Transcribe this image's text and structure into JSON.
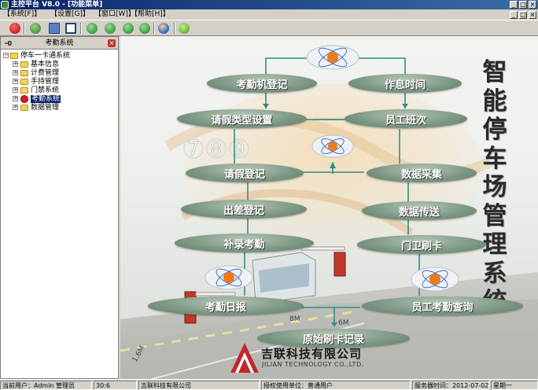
{
  "window": {
    "title": "主控平台 V8.0 - [功能菜单]",
    "controls": [
      "_",
      "□",
      "×"
    ]
  },
  "menu": {
    "items": [
      "【系统[F]】",
      "【设置[G]】",
      "【窗口[W]】",
      "【帮助[H]】"
    ],
    "mdi_controls": [
      "_",
      "□",
      "×"
    ]
  },
  "toolbar": {
    "buttons": [
      "exit-icon",
      "refresh-icon",
      "cascade-icon",
      "tile-icon",
      "first-icon",
      "prev-icon",
      "next-icon",
      "last-icon",
      "globe-icon",
      "home-icon"
    ]
  },
  "sidebar": {
    "title": "考勤系统",
    "root": "停车一卡通系统",
    "items": [
      {
        "label": "基本信息",
        "selected": false
      },
      {
        "label": "计费管理",
        "selected": false
      },
      {
        "label": "手持管理",
        "selected": false
      },
      {
        "label": "门禁系统",
        "selected": false
      },
      {
        "label": "考勤系统",
        "selected": true
      },
      {
        "label": "数据管理",
        "selected": false
      }
    ]
  },
  "main": {
    "vertical_title": [
      "智",
      "能",
      "停",
      "车",
      "场",
      "管",
      "理",
      "系",
      "统"
    ],
    "flow_buttons": {
      "attendance_register": "考勤机登记",
      "work_time": "作息时间",
      "leave_type": "请假类型设置",
      "staff_shift": "员工班次",
      "leave_register": "请假登记",
      "data_collect": "数据采集",
      "business_trip": "出差登记",
      "data_transfer": "数据传送",
      "supplement": "补录考勤",
      "gate_card": "门卫刷卡",
      "daily_report": "考勤日报",
      "staff_query": "员工考勤查询",
      "raw_records": "原始刷卡记录"
    },
    "background_digits": [
      "7",
      "8",
      "9"
    ],
    "road_markings": [
      "8M",
      "6M",
      "1.6M"
    ],
    "logo": {
      "company_cn": "吉联科技有限公司",
      "company_en": "JILIAN TECHNOLOGY CO.,LTD."
    }
  },
  "status": {
    "current_user": "当前用户：Admin 管理员",
    "time": "30:6",
    "company": "吉联科技有限公司",
    "license": "授权使用单位：普通用户",
    "expiry": "服务器时间：2012-07-02",
    "weekday": "星期一"
  },
  "colors": {
    "title_bar": "#0a246a",
    "pill": "#7f9a86",
    "selected": "#0a246a",
    "connector": "#2f8f86",
    "logo_red": "#c0282d"
  }
}
